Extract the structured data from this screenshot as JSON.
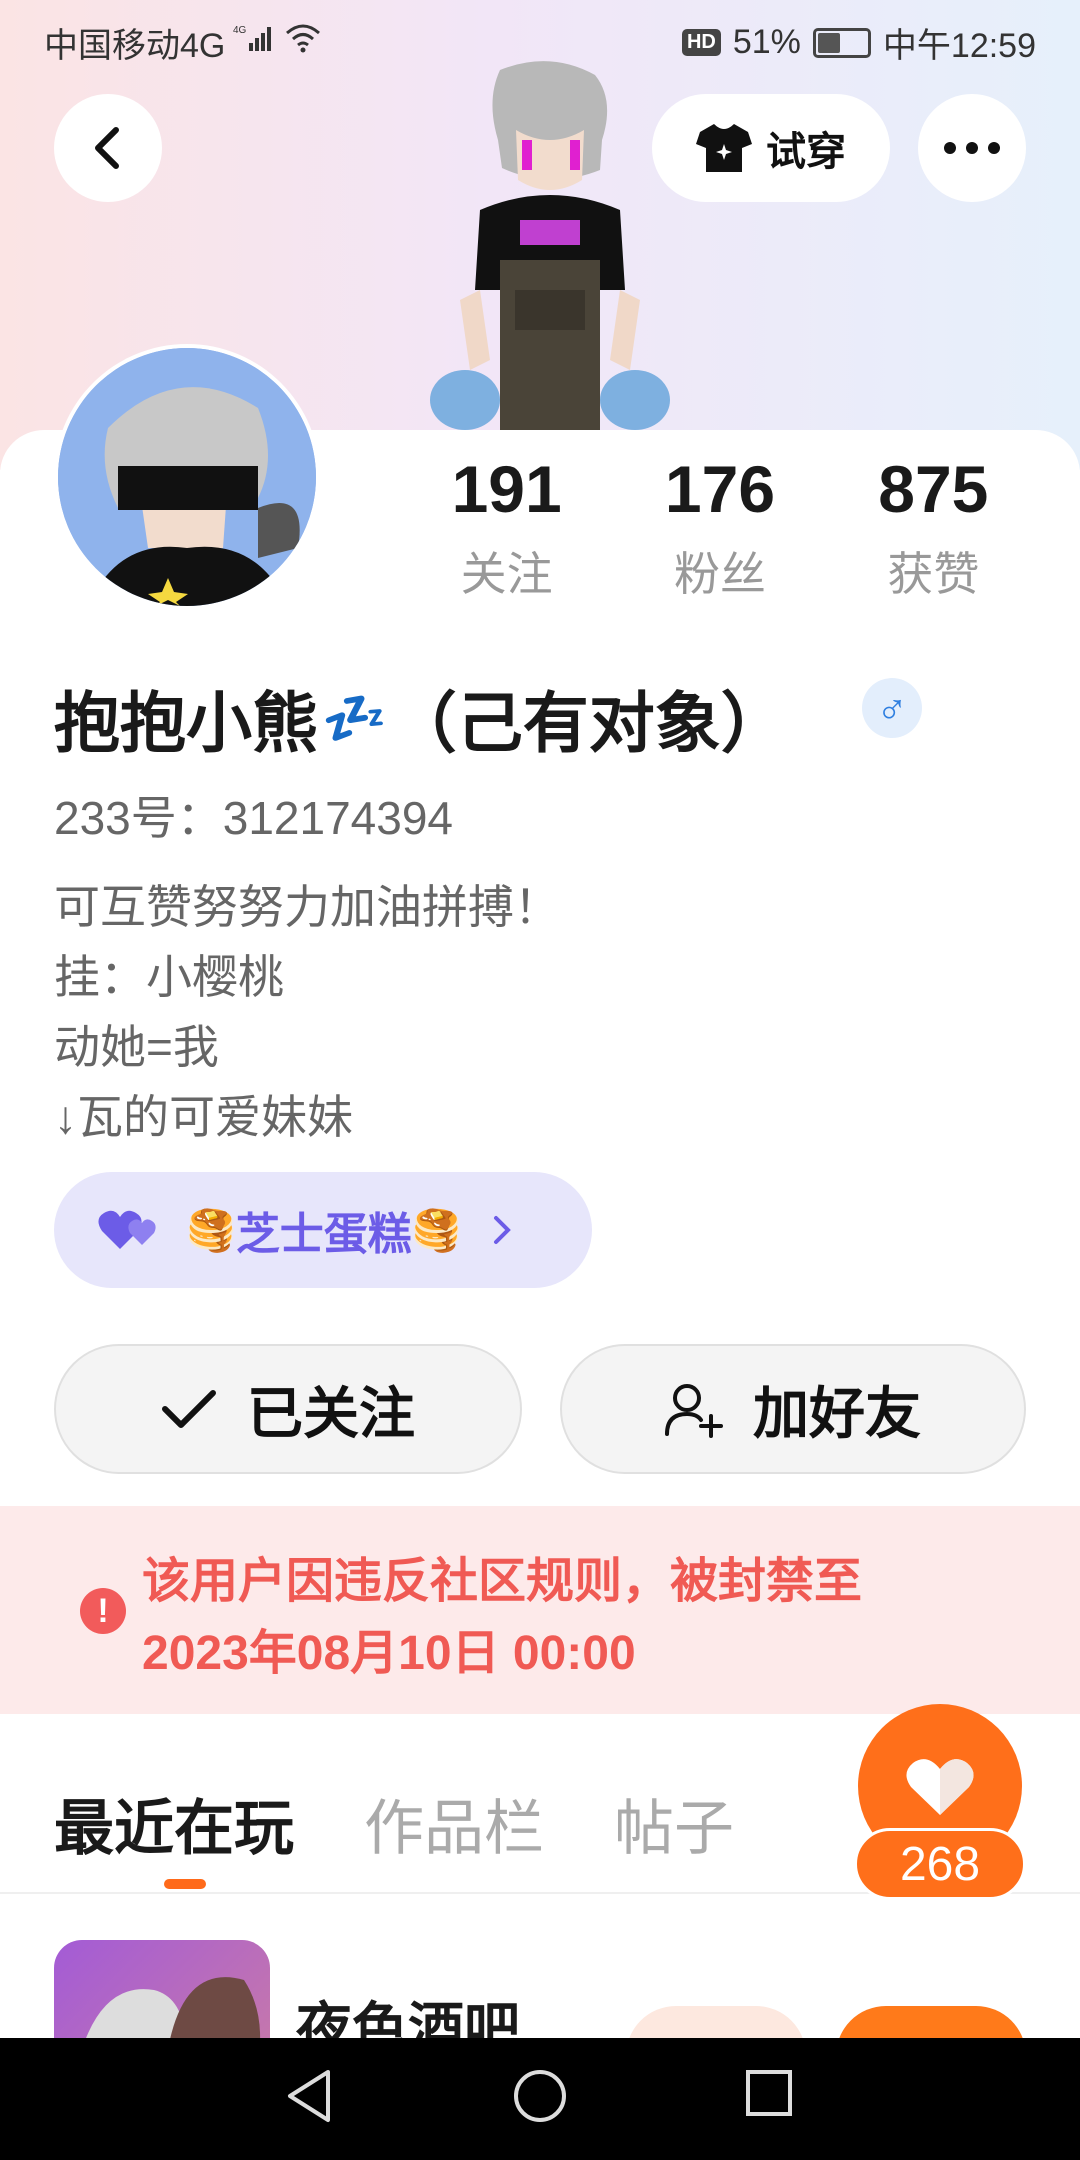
{
  "status_bar": {
    "carrier": "中国移动4G",
    "network_small": "4G",
    "hd": "HD",
    "battery_percent": "51%",
    "battery_level": 0.51,
    "time": "中午12:59"
  },
  "top_bar": {
    "tryon_label": "试穿"
  },
  "stats": [
    {
      "value": "191",
      "label": "关注"
    },
    {
      "value": "176",
      "label": "粉丝"
    },
    {
      "value": "875",
      "label": "获赞"
    }
  ],
  "profile": {
    "name": "抱抱小熊",
    "name_suffix": "（己有对象）",
    "sleep_emoji": "💤",
    "gender_symbol": "♂",
    "id_line": "233号：312174394",
    "bio": [
      "可互赞努努力加油拼搏！",
      "挂：小樱桃",
      "动她=我",
      "↓瓦的可爱妹妹"
    ]
  },
  "group": {
    "label": "芝士蛋糕",
    "emoji": "🥞"
  },
  "actions": {
    "follow_label": "已关注",
    "add_friend_label": "加好友"
  },
  "ban_notice": {
    "line1": "该用户因违反社区规则，被封禁至",
    "line2": "2023年08月10日 00:00"
  },
  "tabs": [
    {
      "label": "最近在玩",
      "active": true
    },
    {
      "label": "作品栏",
      "active": false
    },
    {
      "label": "帖子",
      "active": false
    }
  ],
  "recent_game": {
    "title": "夜色酒吧..."
  },
  "like_fab": {
    "count": "268"
  },
  "colors": {
    "accent_orange": "#ff6f1a",
    "ban_red": "#f05a54",
    "group_purple": "#6c5ce7",
    "gender_blue": "#2f7fe0"
  }
}
